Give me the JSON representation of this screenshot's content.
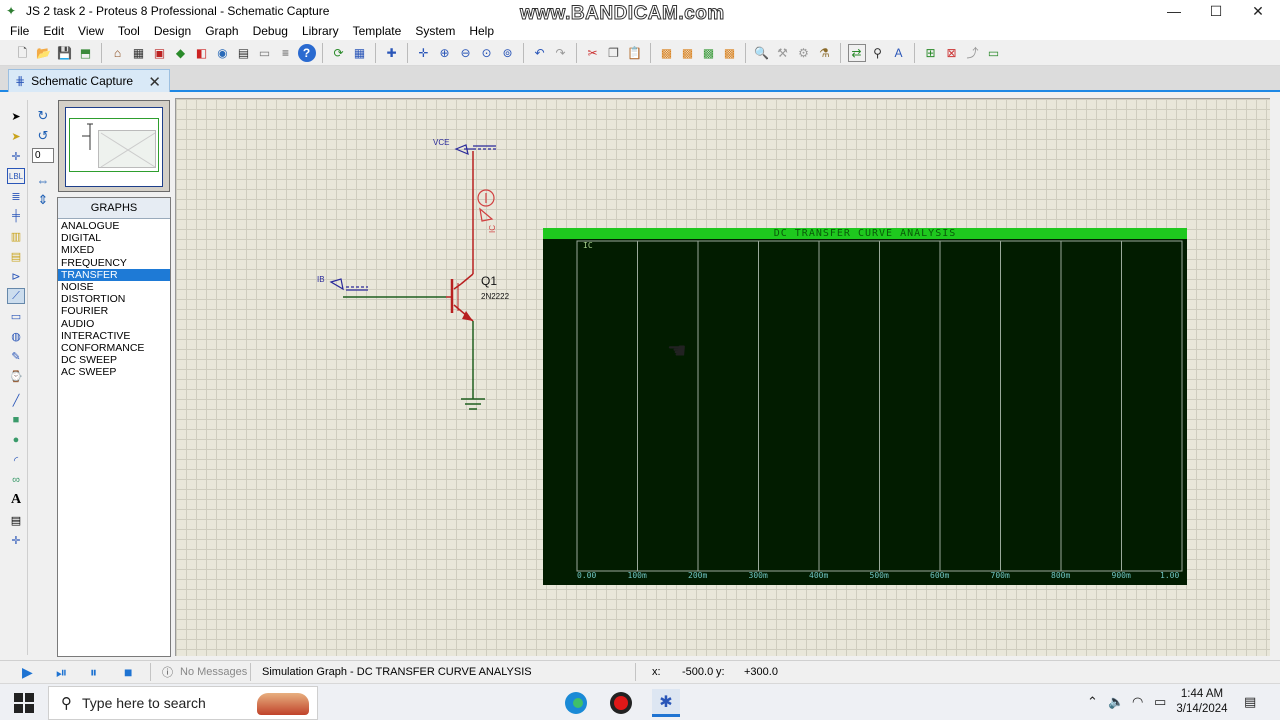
{
  "window": {
    "title": "JS 2 task 2 - Proteus 8 Professional - Schematic Capture",
    "watermark": "www.BANDICAM.com",
    "controls": {
      "minimize": "—",
      "maximize": "☐",
      "close": "✕"
    }
  },
  "menu": [
    "File",
    "Edit",
    "View",
    "Tool",
    "Design",
    "Graph",
    "Debug",
    "Library",
    "Template",
    "System",
    "Help"
  ],
  "tab": {
    "label": "Schematic Capture",
    "close": "✕"
  },
  "left_tools": [
    "select",
    "component",
    "junction",
    "LBL",
    "text-script",
    "bus",
    "sub-circuit",
    "terminals",
    "device-pins",
    "graph",
    "tape",
    "generator",
    "voltage-probe",
    "current-probe",
    "virtual-instruments",
    "line",
    "box",
    "circle",
    "arc",
    "path",
    "A",
    "symbol",
    "marker"
  ],
  "rotation": {
    "angle": "0"
  },
  "graphs_panel": {
    "title": "GRAPHS",
    "items": [
      "ANALOGUE",
      "DIGITAL",
      "MIXED",
      "FREQUENCY",
      "TRANSFER",
      "NOISE",
      "DISTORTION",
      "FOURIER",
      "AUDIO",
      "INTERACTIVE",
      "CONFORMANCE",
      "DC SWEEP",
      "AC SWEEP"
    ],
    "selected": "TRANSFER"
  },
  "schematic": {
    "vce_label": "VCE",
    "ib_label": "IB",
    "probe_label": "IC",
    "transistor_ref": "Q1",
    "transistor_part": "2N2222"
  },
  "graph": {
    "title": "DC TRANSFER CURVE ANALYSIS",
    "trace_label": "IC",
    "x_ticks": [
      "0.00",
      "100m",
      "200m",
      "300m",
      "400m",
      "500m",
      "600m",
      "700m",
      "800m",
      "900m",
      "1.00"
    ],
    "background": "#021c00",
    "title_bar_color": "#1ec81e",
    "grid_color": "#9aa89a"
  },
  "chart_data": {
    "type": "line",
    "title": "DC TRANSFER CURVE ANALYSIS",
    "xlabel": "",
    "ylabel": "IC",
    "x_tick_labels": [
      "0.00",
      "100m",
      "200m",
      "300m",
      "400m",
      "500m",
      "600m",
      "700m",
      "800m",
      "900m",
      "1.00"
    ],
    "xlim": [
      0,
      1
    ],
    "series": [],
    "grid": true
  },
  "status": {
    "messages": "No Messages",
    "info": "Simulation Graph - DC TRANSFER CURVE ANALYSIS",
    "x_label": "x:",
    "x_value": "-500.0",
    "y_label": "y:",
    "y_value": "+300.0"
  },
  "taskbar": {
    "search_placeholder": "Type here to search",
    "time": "1:44 AM",
    "date": "3/14/2024"
  }
}
